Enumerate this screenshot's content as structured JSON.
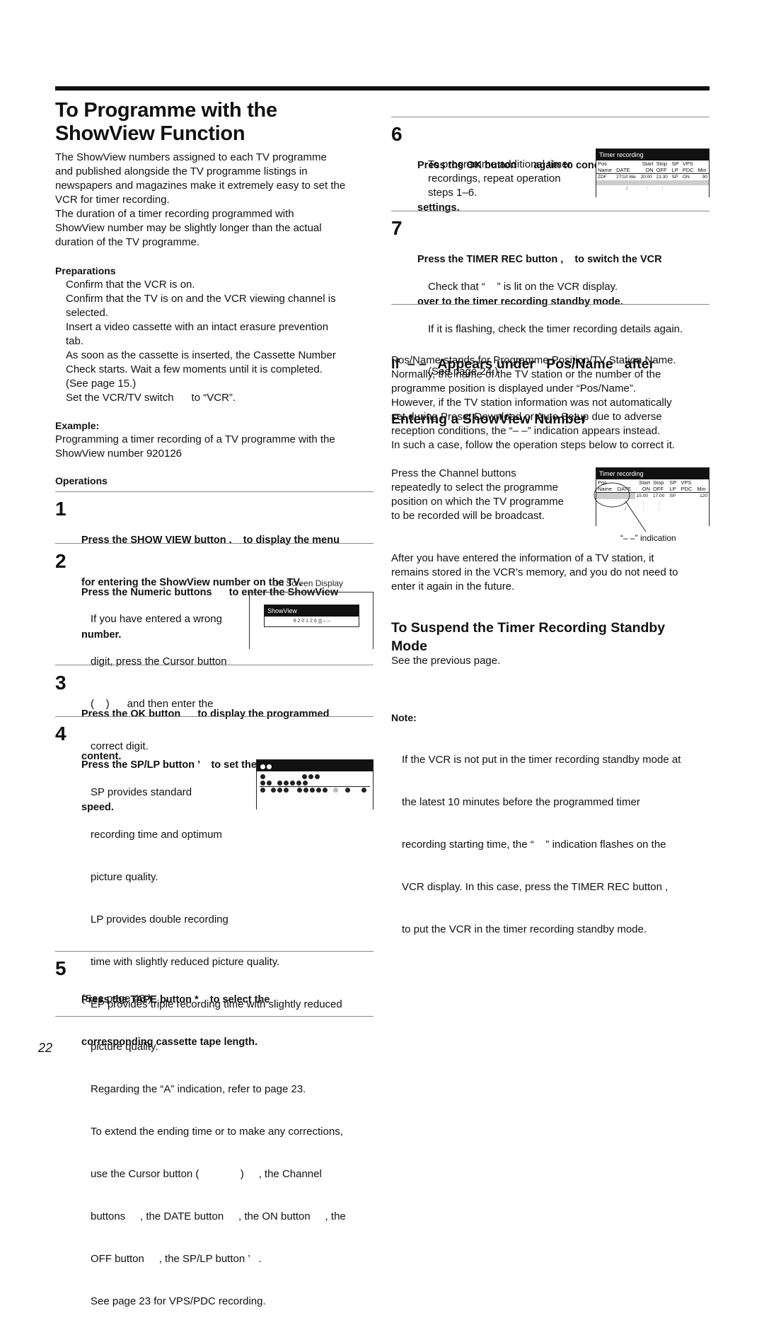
{
  "page": {
    "title": "To Programme with the ShowView Function",
    "title_line1": "To Programme with the",
    "title_line2": "ShowView Function",
    "page_number": "22"
  },
  "intro": [
    "The ShowView numbers assigned to each TV programme",
    "and published alongside the TV programme listings in",
    "newspapers and magazines make it extremely easy to set the",
    "VCR for timer recording.",
    "The duration of a timer recording programmed with",
    "ShowView number may be slightly longer than the actual",
    "duration of the TV programme."
  ],
  "preparations": {
    "heading": "Preparations",
    "lines": [
      "Confirm that the VCR is on.",
      "Confirm that the TV is on and the VCR viewing channel is",
      "selected.",
      "Insert a video cassette with an intact erasure prevention",
      "tab.",
      "As soon as the cassette is inserted, the Cassette Number",
      "Check starts. Wait a few moments until it is completed.",
      "(See page 15.)",
      "Set the VCR/TV switch      to “VCR”."
    ]
  },
  "example": {
    "heading": "Example:",
    "lines": [
      "Programming a timer recording of a TV programme with the",
      "ShowView number 920126"
    ]
  },
  "operations": {
    "heading": "Operations",
    "steps": [
      {
        "num": "1",
        "title": [
          "Press the SHOW VIEW button .    to display the menu",
          "for entering the ShowView number on the TV."
        ],
        "body": []
      },
      {
        "num": "2",
        "title": [
          "Press the Numeric buttons      to enter the ShowView",
          "number."
        ],
        "body": [
          "If you have entered a wrong",
          "digit, press the Cursor button",
          "(    )      and then enter the",
          "correct digit."
        ]
      },
      {
        "num": "3",
        "title": [
          "Press the OK button      to display the programmed",
          "content."
        ],
        "body": []
      },
      {
        "num": "4",
        "title": [
          "Press the SP/LP button ’    to set the desired tape",
          "speed."
        ],
        "body": [
          "SP provides standard",
          "recording time and optimum",
          "picture quality.",
          "LP provides double recording",
          "time with slightly reduced picture quality.",
          "EP provides triple recording time with slightly reduced",
          "picture quality.",
          "Regarding the “A” indication, refer to page 23.",
          "To extend the ending time or to make any corrections,",
          "use the Cursor button (              )     , the Channel",
          "buttons     , the DATE button     , the ON button     , the",
          "OFF button     , the SP/LP button ’   .",
          "See page 23 for VPS/PDC recording."
        ]
      },
      {
        "num": "5",
        "title": [
          "Press the TAPE button *    to select the",
          "corresponding cassette tape length."
        ],
        "body": [
          "(See page 48.)"
        ]
      },
      {
        "num": "6",
        "title": [
          "Press the OK button      again to conclude the",
          "settings."
        ],
        "body": [
          "To programme additional timer",
          "recordings, repeat operation",
          "steps 1–6."
        ]
      },
      {
        "num": "7",
        "title": [
          "Press the TIMER REC button ,    to switch the VCR",
          "over to the timer recording standby mode."
        ],
        "body": [
          "Check that “    ” is lit on the VCR display.",
          "If it is flashing, check the timer recording details again.",
          "(See page 24.)"
        ]
      }
    ]
  },
  "osd_showview": {
    "caption": "On Screen Display",
    "title": "ShowView",
    "value": "9 2 0 1 2 6",
    "remaining": "– –"
  },
  "osd_timer1": {
    "title": "Timer recording",
    "headers_row1": [
      "Pos",
      "",
      "Start",
      "Stop",
      "SP",
      "VPS",
      ""
    ],
    "headers_row2": [
      "Name",
      "DATE",
      "ON",
      "OFF",
      "LP",
      "PDC",
      "Min"
    ],
    "row": [
      "ZDF",
      "27/10 We",
      "20:00",
      "21:30",
      "SP",
      "ON",
      "90"
    ],
    "empty_date": "/",
    "empty_time": ":"
  },
  "osd_timer2": {
    "title": "Timer recording",
    "headers_row1": [
      "Pos",
      "",
      "Start",
      "Stop",
      "SP",
      "VPS",
      ""
    ],
    "headers_row2": [
      "Name",
      "DATE",
      "ON",
      "OFF",
      "LP",
      "PDC",
      "Min"
    ],
    "row": [
      "",
      "",
      "15:00",
      "17:00",
      "SP",
      "",
      "120"
    ],
    "empty_date": "/",
    "empty_time": ":",
    "callout": "“– –” indication"
  },
  "section_dash": {
    "heading_line1": "If  – –   Appears under   Pos/Name   after",
    "heading_line2": "Entering a ShowView Number",
    "lines": [
      "Pos/Name stands for Programme Position/TV Station Name.",
      "Normally, the name of the TV station or the number of the",
      "programme position is displayed under “Pos/Name”.",
      "However, if the TV station information was not automatically",
      "set during Preset Download or Auto Setup due to adverse",
      "reception conditions, the “– –” indication appears instead.",
      "In such a case, follow the operation steps below to correct it."
    ],
    "channel_lines": [
      "Press the Channel buttons",
      "repeatedly to select the programme",
      "position on which the TV programme",
      "to be recorded will be broadcast."
    ],
    "after_lines": [
      "After you have entered the information of a TV station, it",
      "remains stored in the VCR’s memory, and you do not need to",
      "enter it again in the future."
    ]
  },
  "section_suspend": {
    "heading_line1": "To Suspend the Timer Recording Standby",
    "heading_line2": "Mode",
    "text": "See the previous page.",
    "note_heading": "Note:",
    "note_lines": [
      "If the VCR is not put in the timer recording standby mode at",
      "the latest 10 minutes before the programmed timer",
      "recording starting time, the “    ” indication flashes on the",
      "VCR display. In this case, press the TIMER REC button ,",
      "to put the VCR in the timer recording standby mode."
    ]
  }
}
